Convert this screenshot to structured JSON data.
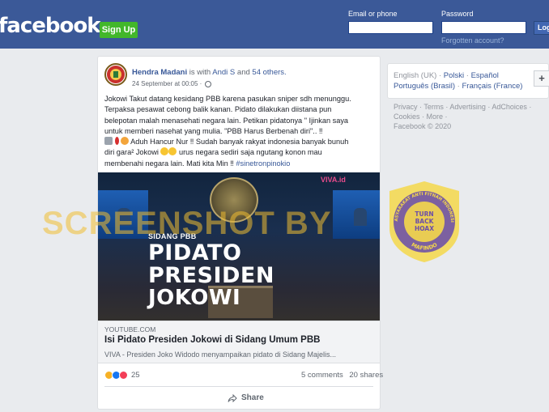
{
  "header": {
    "logo": "facebook",
    "signup_label": "Sign Up",
    "email_label": "Email or phone",
    "password_label": "Password",
    "email_value": "",
    "password_value": "",
    "forgot_label": "Forgotten account?",
    "login_label": "Log"
  },
  "post": {
    "author": "Hendra Madani",
    "with_text": " is with ",
    "tagged": "Andi S",
    "and_text": " and ",
    "others": "54 others.",
    "time": "24 September at 00:05 ·",
    "line1": "Jokowi Takut datang kesidang PBB karena pasukan sniper sdh menunggu.",
    "line2": "Terpaksa pesawat cebong balik kanan. Pidato dilakukan diistana pun",
    "line3": "belepotan malah menasehati negara lain. Petikan pidatonya \" Ijinkan saya",
    "line4": "untuk memberi nasehat yang mulia. \"PBB Harus Berbenah diri\".. ‼",
    "line5": "Aduh Hancur Nur ‼ Sudah banyak rakyat indonesia banyak bunuh",
    "line6_a": "diri gara² Jokowi",
    "line6_b": "urus negara sediri saja ngutang konon mau",
    "line7_a": "membenahi negara lain. Mati kita Min ‼",
    "hashtag": "#sinetronpinokio"
  },
  "media": {
    "subtitle": "SIDANG PBB",
    "line1": "PIDATO",
    "line2": "PRESIDEN",
    "line3": "JOKOWI",
    "brand": "VIVA.id"
  },
  "link": {
    "domain": "YOUTUBE.COM",
    "title": "Isi Pidato Presiden Jokowi di Sidang Umum PBB",
    "description": "VIVA - Presiden Joko Widodo menyampaikan pidato di Sidang Majelis..."
  },
  "engagement": {
    "reactions": "25",
    "comments": "5 comments",
    "shares": "20 shares",
    "share_label": "Share"
  },
  "sidebar": {
    "lang_current": "English (UK) ·",
    "lang_1": "Polski",
    "lang_2": "Español",
    "lang_3": "Português (Brasil)",
    "lang_4": "Français (France)",
    "plus": "+",
    "footer_line1": "Privacy · Terms · Advertising · AdChoices ·",
    "footer_line2": "Cookies · More ·",
    "footer_line3": "Facebook © 2020"
  },
  "overlay": {
    "watermark": "SCREENSHOT BY",
    "seal_top": "MASYARAKAT ANTI FITNAH INDONESIA",
    "seal_center_1": "TURN",
    "seal_center_2": "BACK",
    "seal_center_3": "HOAX",
    "seal_bottom": "MAFINDO"
  },
  "colors": {
    "facebook_blue": "#3b5998",
    "signup_green": "#42b72a",
    "link_blue": "#385898",
    "watermark_yellow": "#f0be32",
    "seal_purple": "#6b4ea8",
    "seal_yellow": "#f5d84a"
  }
}
